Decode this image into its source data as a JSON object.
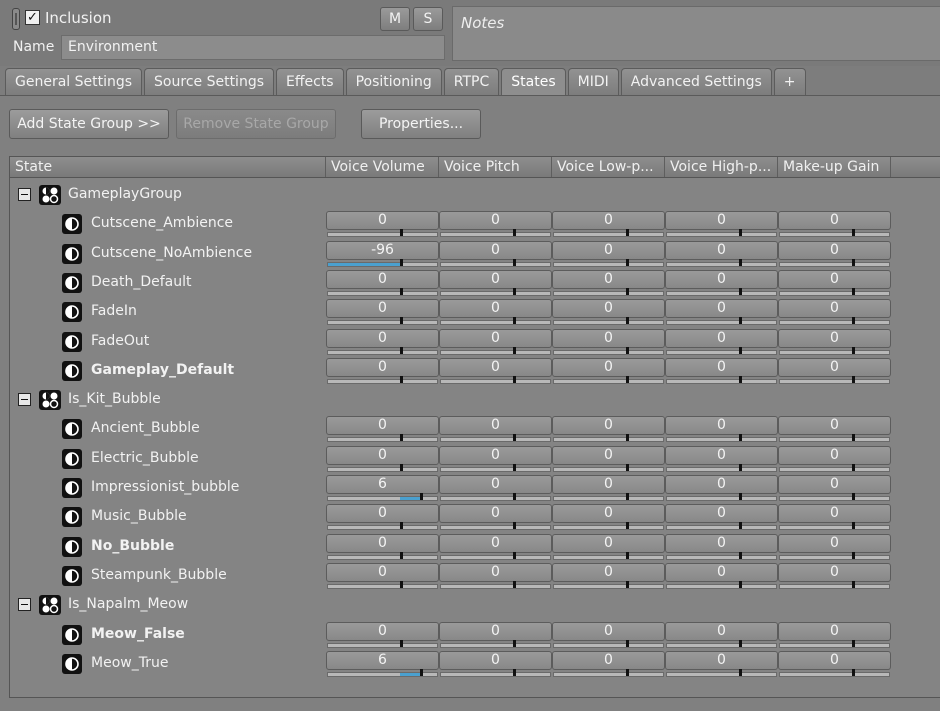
{
  "header": {
    "inclusion_label": "Inclusion",
    "inclusion_checked": true,
    "mute_label": "M",
    "solo_label": "S",
    "name_label": "Name",
    "name_value": "Environment",
    "notes_placeholder": "Notes"
  },
  "tabs": [
    {
      "label": "General Settings",
      "active": false
    },
    {
      "label": "Source Settings",
      "active": false
    },
    {
      "label": "Effects",
      "active": false
    },
    {
      "label": "Positioning",
      "active": false
    },
    {
      "label": "RTPC",
      "active": false
    },
    {
      "label": "States",
      "active": true
    },
    {
      "label": "MIDI",
      "active": false
    },
    {
      "label": "Advanced Settings",
      "active": false
    },
    {
      "label": "+",
      "active": false
    }
  ],
  "toolbar": {
    "add_state_group": "Add State Group >>",
    "remove_state_group": "Remove State Group",
    "properties": "Properties..."
  },
  "grid": {
    "columns": [
      "State",
      "Voice Volume",
      "Voice Pitch",
      "Voice Low-p...",
      "Voice High-p...",
      "Make-up Gain"
    ],
    "groups": [
      {
        "name": "GameplayGroup",
        "states": [
          {
            "name": "Cutscene_Ambience",
            "bold": false,
            "values": [
              0,
              0,
              0,
              0,
              0
            ]
          },
          {
            "name": "Cutscene_NoAmbience",
            "bold": false,
            "values": [
              -96,
              0,
              0,
              0,
              0
            ]
          },
          {
            "name": "Death_Default",
            "bold": false,
            "values": [
              0,
              0,
              0,
              0,
              0
            ]
          },
          {
            "name": "FadeIn",
            "bold": false,
            "values": [
              0,
              0,
              0,
              0,
              0
            ]
          },
          {
            "name": "FadeOut",
            "bold": false,
            "values": [
              0,
              0,
              0,
              0,
              0
            ]
          },
          {
            "name": "Gameplay_Default",
            "bold": true,
            "values": [
              0,
              0,
              0,
              0,
              0
            ]
          }
        ]
      },
      {
        "name": "Is_Kit_Bubble",
        "states": [
          {
            "name": "Ancient_Bubble",
            "bold": false,
            "values": [
              0,
              0,
              0,
              0,
              0
            ]
          },
          {
            "name": "Electric_Bubble",
            "bold": false,
            "values": [
              0,
              0,
              0,
              0,
              0
            ]
          },
          {
            "name": "Impressionist_bubble",
            "bold": false,
            "values": [
              6,
              0,
              0,
              0,
              0
            ]
          },
          {
            "name": "Music_Bubble",
            "bold": false,
            "values": [
              0,
              0,
              0,
              0,
              0
            ]
          },
          {
            "name": "No_Bubble",
            "bold": true,
            "values": [
              0,
              0,
              0,
              0,
              0
            ]
          },
          {
            "name": "Steampunk_Bubble",
            "bold": false,
            "values": [
              0,
              0,
              0,
              0,
              0
            ]
          }
        ]
      },
      {
        "name": "Is_Napalm_Meow",
        "states": [
          {
            "name": "Meow_False",
            "bold": true,
            "values": [
              0,
              0,
              0,
              0,
              0
            ]
          },
          {
            "name": "Meow_True",
            "bold": false,
            "values": [
              6,
              0,
              0,
              0,
              0
            ]
          }
        ]
      }
    ]
  },
  "colors": {
    "accent_fill": "#4aa0cf"
  },
  "icons": {
    "group": "state-group-icon",
    "state": "state-icon",
    "expander": "collapse-icon"
  }
}
